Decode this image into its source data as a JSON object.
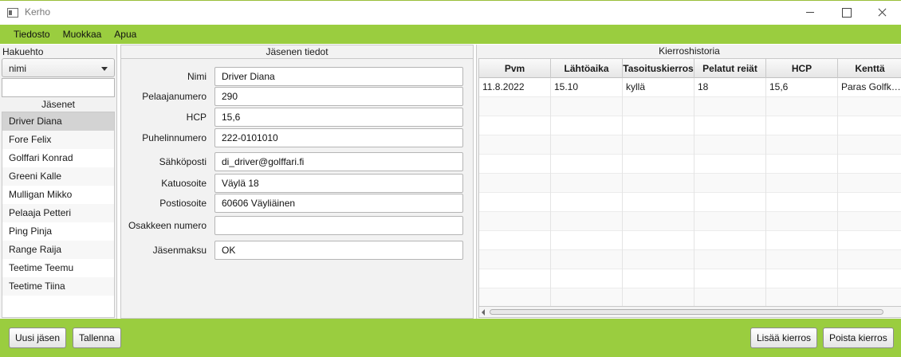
{
  "window": {
    "title": "Kerho"
  },
  "menu": [
    "Tiedosto",
    "Muokkaa",
    "Apua"
  ],
  "left": {
    "search_label": "Hakuehto",
    "search_field_value": "nimi",
    "search_text": "",
    "members_label": "Jäsenet",
    "members": [
      "Driver Diana",
      "Fore Felix",
      "Golffari Konrad",
      "Greeni Kalle",
      "Mulligan Mikko",
      "Pelaaja Petteri",
      "Ping Pinja",
      "Range Raija",
      "Teetime Teemu",
      "Teetime Tiina"
    ],
    "selected_index": 0
  },
  "details": {
    "header": "Jäsenen tiedot",
    "fields": [
      {
        "label": "Nimi",
        "value": "Driver Diana"
      },
      {
        "label": "Pelaajanumero",
        "value": "290"
      },
      {
        "label": "HCP",
        "value": "15,6"
      },
      {
        "label": "Puhelinnumero",
        "value": "222-0101010"
      },
      {
        "label": "Sähköposti",
        "value": "di_driver@golffari.fi"
      },
      {
        "label": "Katuosoite",
        "value": "Väylä 18"
      },
      {
        "label": "Postiosoite",
        "value": "60606 Väyliäinen"
      },
      {
        "label": "Osakkeen numero",
        "value": ""
      },
      {
        "label": "Jäsenmaksu",
        "value": "OK"
      }
    ]
  },
  "history": {
    "header": "Kierroshistoria",
    "columns": [
      "Pvm",
      "Lähtöaika",
      "Tasoituskierros",
      "Pelatut reiät",
      "HCP",
      "Kenttä"
    ],
    "rows": [
      [
        "11.8.2022",
        "15.10",
        "kyllä",
        "18",
        "15,6",
        "Paras Golfker..."
      ]
    ],
    "empty_rows": 11
  },
  "buttons": {
    "new_member": "Uusi jäsen",
    "save": "Tallenna",
    "add_round": "Lisää kierros",
    "delete_round": "Poista kierros"
  },
  "colors": {
    "accent": "#9acd3f"
  }
}
